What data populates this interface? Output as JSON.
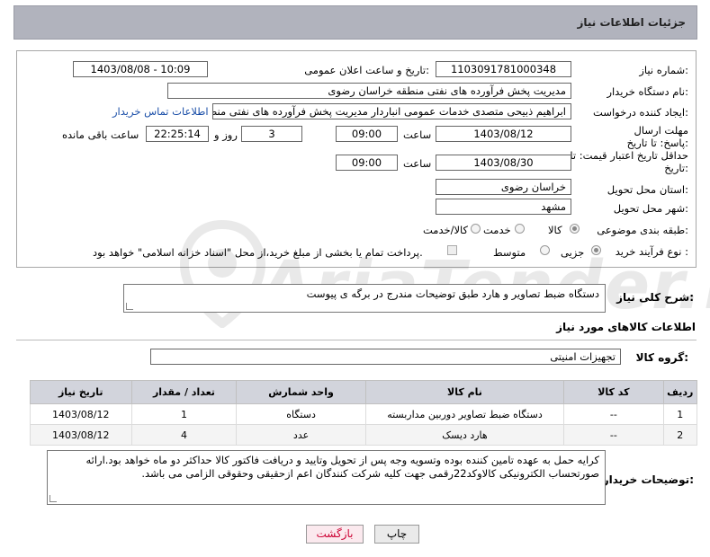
{
  "header": {
    "title": "جزئیات اطلاعات نیاز"
  },
  "form": {
    "need_number_label": "شماره نیاز:",
    "need_number": "1103091781000348",
    "announce_label": "تاریخ و ساعت اعلان عمومی:",
    "announce_value": "1403/08/08 - 10:09",
    "buyer_org_label": "نام دستگاه خریدار:",
    "buyer_org": "مدیریت پخش فرآورده های نفتی منطقه خراسان رضوی",
    "creator_label": "ایجاد کننده درخواست:",
    "creator": "ابراهیم ذبیحی متصدی خدمات عمومی انباردار مدیریت پخش فرآورده های نفتی منطقه",
    "contact_link": "اطلاعات تماس خریدار",
    "reply_deadline_label": "مهلت ارسال پاسخ: تا تاریخ:",
    "reply_date": "1403/08/12",
    "time_label": "ساعت",
    "reply_time": "09:00",
    "days_count": "3",
    "days_label": "روز و",
    "remaining_time": "22:25:14",
    "remaining_label": "ساعت باقی مانده",
    "price_validity_label": "حداقل تاریخ اعتبار قیمت: تا تاریخ:",
    "price_date": "1403/08/30",
    "price_time_label": "ساعت",
    "price_time": "09:00",
    "province_label": "استان محل تحویل:",
    "province": "خراسان رضوی",
    "city_label": "شهر محل تحویل:",
    "city": "مشهد",
    "category_label": "طبقه بندی موضوعی:",
    "category_options": [
      "کالا",
      "خدمت",
      "کالا/خدمت"
    ],
    "process_label": "نوع فرآیند خرید :",
    "process_options": [
      "جزیی",
      "متوسط"
    ],
    "payment_note": "پرداخت تمام یا بخشی از مبلغ خرید،از محل \"اسناد خزانه اسلامی\" خواهد بود."
  },
  "general_desc": {
    "label": "شرح کلی نیاز:",
    "value": "دستگاه ضبط تصاویر و هارد طبق توضیحات مندرج در برگه ی پیوست"
  },
  "goods": {
    "section_title": "اطلاعات کالاهای مورد نیاز",
    "group_label": "گروه کالا:",
    "group_value": "تجهیزات امنیتی",
    "columns": [
      "ردیف",
      "کد کالا",
      "نام کالا",
      "واحد شمارش",
      "تعداد / مقدار",
      "تاریخ نیاز"
    ],
    "rows": [
      [
        "1",
        "--",
        "دستگاه ضبط تصاویر دوربین مداربسته",
        "دستگاه",
        "1",
        "1403/08/12"
      ],
      [
        "2",
        "--",
        "هارد دیسک",
        "عدد",
        "4",
        "1403/08/12"
      ]
    ]
  },
  "buyer_notes": {
    "label": "توضیحات خریدار:",
    "value": "کرایه حمل به عهده تامین کننده بوده وتسویه وجه پس از تحویل وتایید و دریافت فاکتور کالا حداکثر دو ماه خواهد بود.ارائه صورتحساب الکترونیکی کالاوکد22رقمی جهت کلیه شرکت کنندگان اعم ازحقیقی وحقوقی الزامی می باشد."
  },
  "buttons": {
    "print": "چاپ",
    "back": "بازگشت"
  },
  "watermark": {
    "text": "AriaTender.net"
  }
}
